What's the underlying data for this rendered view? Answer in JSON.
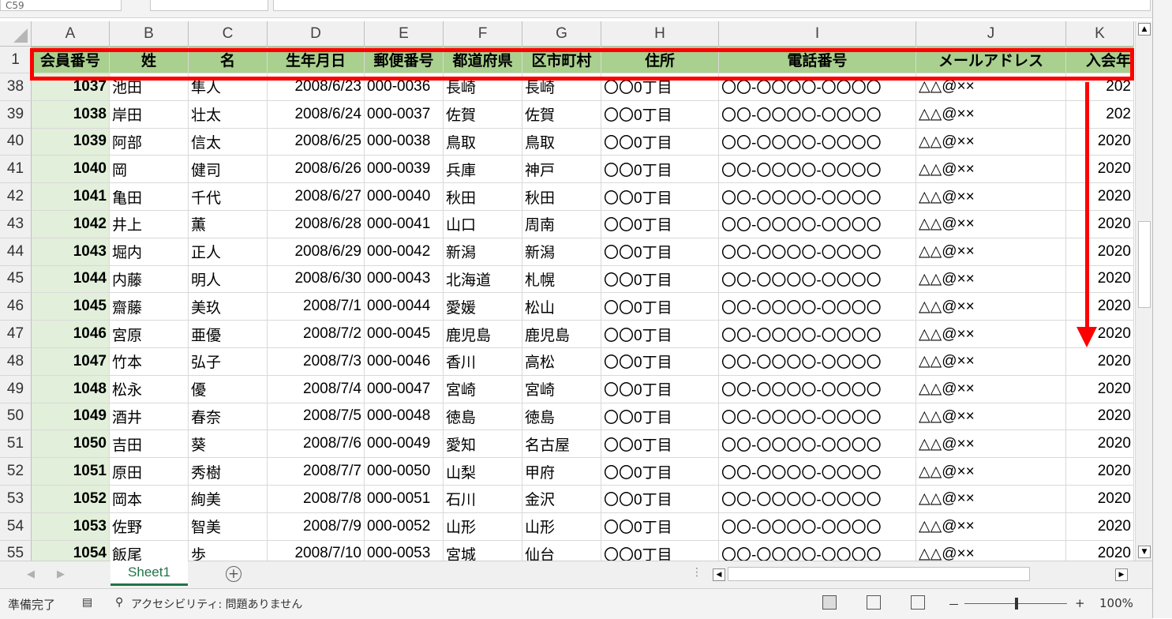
{
  "columns": [
    {
      "letter": "A",
      "header": "会員番号"
    },
    {
      "letter": "B",
      "header": "姓"
    },
    {
      "letter": "C",
      "header": "名"
    },
    {
      "letter": "D",
      "header": "生年月日"
    },
    {
      "letter": "E",
      "header": "郵便番号"
    },
    {
      "letter": "F",
      "header": "都道府県"
    },
    {
      "letter": "G",
      "header": "区市町村"
    },
    {
      "letter": "H",
      "header": "住所"
    },
    {
      "letter": "I",
      "header": "電話番号"
    },
    {
      "letter": "J",
      "header": "メールアドレス"
    },
    {
      "letter": "K",
      "header": "入会年"
    }
  ],
  "header_row_number": "1",
  "rows": [
    {
      "num": "38",
      "id": "1037",
      "last": "池田",
      "first": "隼人",
      "birth": "2008/6/23",
      "zip": "000-0036",
      "pref": "長崎",
      "city": "長崎",
      "addr": "〇〇0丁目",
      "tel": "〇〇-〇〇〇〇-〇〇〇〇",
      "mail": "△△@××",
      "year": "202"
    },
    {
      "num": "39",
      "id": "1038",
      "last": "岸田",
      "first": "壮太",
      "birth": "2008/6/24",
      "zip": "000-0037",
      "pref": "佐賀",
      "city": "佐賀",
      "addr": "〇〇0丁目",
      "tel": "〇〇-〇〇〇〇-〇〇〇〇",
      "mail": "△△@××",
      "year": "202"
    },
    {
      "num": "40",
      "id": "1039",
      "last": "阿部",
      "first": "信太",
      "birth": "2008/6/25",
      "zip": "000-0038",
      "pref": "鳥取",
      "city": "鳥取",
      "addr": "〇〇0丁目",
      "tel": "〇〇-〇〇〇〇-〇〇〇〇",
      "mail": "△△@××",
      "year": "2020"
    },
    {
      "num": "41",
      "id": "1040",
      "last": "岡",
      "first": "健司",
      "birth": "2008/6/26",
      "zip": "000-0039",
      "pref": "兵庫",
      "city": "神戸",
      "addr": "〇〇0丁目",
      "tel": "〇〇-〇〇〇〇-〇〇〇〇",
      "mail": "△△@××",
      "year": "2020"
    },
    {
      "num": "42",
      "id": "1041",
      "last": "亀田",
      "first": "千代",
      "birth": "2008/6/27",
      "zip": "000-0040",
      "pref": "秋田",
      "city": "秋田",
      "addr": "〇〇0丁目",
      "tel": "〇〇-〇〇〇〇-〇〇〇〇",
      "mail": "△△@××",
      "year": "2020"
    },
    {
      "num": "43",
      "id": "1042",
      "last": "井上",
      "first": "薫",
      "birth": "2008/6/28",
      "zip": "000-0041",
      "pref": "山口",
      "city": "周南",
      "addr": "〇〇0丁目",
      "tel": "〇〇-〇〇〇〇-〇〇〇〇",
      "mail": "△△@××",
      "year": "2020"
    },
    {
      "num": "44",
      "id": "1043",
      "last": "堀内",
      "first": "正人",
      "birth": "2008/6/29",
      "zip": "000-0042",
      "pref": "新潟",
      "city": "新潟",
      "addr": "〇〇0丁目",
      "tel": "〇〇-〇〇〇〇-〇〇〇〇",
      "mail": "△△@××",
      "year": "2020"
    },
    {
      "num": "45",
      "id": "1044",
      "last": "内藤",
      "first": "明人",
      "birth": "2008/6/30",
      "zip": "000-0043",
      "pref": "北海道",
      "city": "札幌",
      "addr": "〇〇0丁目",
      "tel": "〇〇-〇〇〇〇-〇〇〇〇",
      "mail": "△△@××",
      "year": "2020"
    },
    {
      "num": "46",
      "id": "1045",
      "last": "齋藤",
      "first": "美玖",
      "birth": "2008/7/1",
      "zip": "000-0044",
      "pref": "愛媛",
      "city": "松山",
      "addr": "〇〇0丁目",
      "tel": "〇〇-〇〇〇〇-〇〇〇〇",
      "mail": "△△@××",
      "year": "2020"
    },
    {
      "num": "47",
      "id": "1046",
      "last": "宮原",
      "first": "亜優",
      "birth": "2008/7/2",
      "zip": "000-0045",
      "pref": "鹿児島",
      "city": "鹿児島",
      "addr": "〇〇0丁目",
      "tel": "〇〇-〇〇〇〇-〇〇〇〇",
      "mail": "△△@××",
      "year": "2020"
    },
    {
      "num": "48",
      "id": "1047",
      "last": "竹本",
      "first": "弘子",
      "birth": "2008/7/3",
      "zip": "000-0046",
      "pref": "香川",
      "city": "高松",
      "addr": "〇〇0丁目",
      "tel": "〇〇-〇〇〇〇-〇〇〇〇",
      "mail": "△△@××",
      "year": "2020"
    },
    {
      "num": "49",
      "id": "1048",
      "last": "松永",
      "first": "優",
      "birth": "2008/7/4",
      "zip": "000-0047",
      "pref": "宮崎",
      "city": "宮崎",
      "addr": "〇〇0丁目",
      "tel": "〇〇-〇〇〇〇-〇〇〇〇",
      "mail": "△△@××",
      "year": "2020"
    },
    {
      "num": "50",
      "id": "1049",
      "last": "酒井",
      "first": "春奈",
      "birth": "2008/7/5",
      "zip": "000-0048",
      "pref": "徳島",
      "city": "徳島",
      "addr": "〇〇0丁目",
      "tel": "〇〇-〇〇〇〇-〇〇〇〇",
      "mail": "△△@××",
      "year": "2020"
    },
    {
      "num": "51",
      "id": "1050",
      "last": "吉田",
      "first": "葵",
      "birth": "2008/7/6",
      "zip": "000-0049",
      "pref": "愛知",
      "city": "名古屋",
      "addr": "〇〇0丁目",
      "tel": "〇〇-〇〇〇〇-〇〇〇〇",
      "mail": "△△@××",
      "year": "2020"
    },
    {
      "num": "52",
      "id": "1051",
      "last": "原田",
      "first": "秀樹",
      "birth": "2008/7/7",
      "zip": "000-0050",
      "pref": "山梨",
      "city": "甲府",
      "addr": "〇〇0丁目",
      "tel": "〇〇-〇〇〇〇-〇〇〇〇",
      "mail": "△△@××",
      "year": "2020"
    },
    {
      "num": "53",
      "id": "1052",
      "last": "岡本",
      "first": "絢美",
      "birth": "2008/7/8",
      "zip": "000-0051",
      "pref": "石川",
      "city": "金沢",
      "addr": "〇〇0丁目",
      "tel": "〇〇-〇〇〇〇-〇〇〇〇",
      "mail": "△△@××",
      "year": "2020"
    },
    {
      "num": "54",
      "id": "1053",
      "last": "佐野",
      "first": "智美",
      "birth": "2008/7/9",
      "zip": "000-0052",
      "pref": "山形",
      "city": "山形",
      "addr": "〇〇0丁目",
      "tel": "〇〇-〇〇〇〇-〇〇〇〇",
      "mail": "△△@××",
      "year": "2020"
    },
    {
      "num": "55",
      "id": "1054",
      "last": "飯尾",
      "first": "歩",
      "birth": "2008/7/10",
      "zip": "000-0053",
      "pref": "宮城",
      "city": "仙台",
      "addr": "〇〇0丁目",
      "tel": "〇〇-〇〇〇〇-〇〇〇〇",
      "mail": "△△@××",
      "year": "2020"
    }
  ],
  "namebox": "C59",
  "sheet_tab": "Sheet1",
  "status": {
    "ready": "準備完了",
    "accessibility": "アクセシビリティ: 問題ありません",
    "zoom": "100%",
    "zoom_minus": "－",
    "zoom_plus": "+"
  },
  "colors": {
    "header_fill": "#a9d08e",
    "id_column_fill": "#e2efda",
    "highlight": "#ff0000",
    "sheet_tab_accent": "#217346"
  },
  "icons": {
    "vscroll_up": "▲",
    "vscroll_down": "▼",
    "hscroll_left": "◀",
    "hscroll_right": "▶",
    "add_sheet": "+",
    "nav_prev": "◀",
    "nav_next": "▶"
  }
}
